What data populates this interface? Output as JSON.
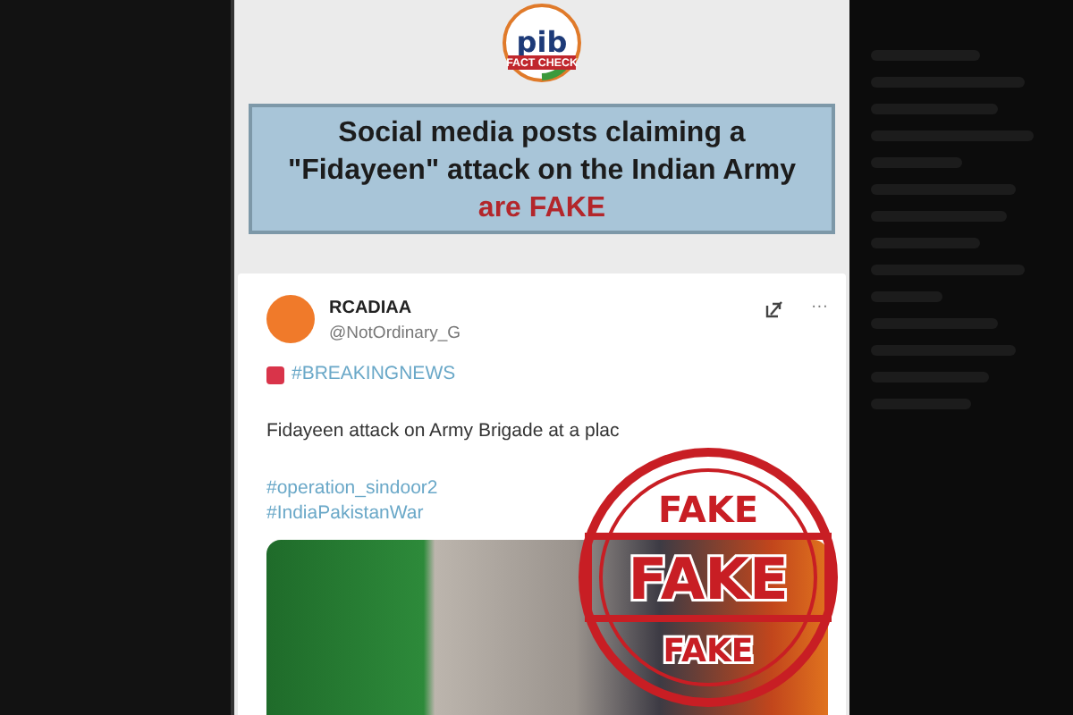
{
  "logo": {
    "text": "pib",
    "subtext": "FACT CHECK"
  },
  "banner": {
    "lines": [
      "Social media posts claiming a",
      "\"Fidayeen\" attack on the Indian Army"
    ],
    "verdict": "are FAKE"
  },
  "tweet": {
    "name": "RCADIAA",
    "handle": "@NotOrdinary_G",
    "headline": "#BREAKINGNEWS",
    "body": "Fidayeen attack on Army Brigade at a plac",
    "hashtags": [
      "#operation_sindoor2",
      "#IndiaPakistanWar"
    ],
    "more": "···"
  },
  "stamp": {
    "texts": [
      "FAKE",
      "FAKE",
      "FAKE"
    ]
  }
}
